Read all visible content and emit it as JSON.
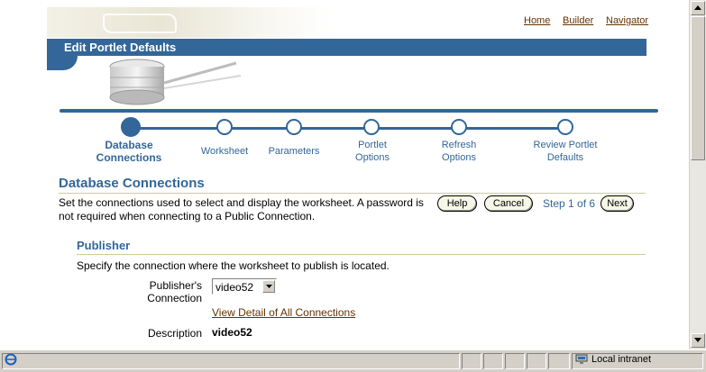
{
  "global_links": [
    "Home",
    "Builder",
    "Navigator"
  ],
  "page_title": "Edit Portlet Defaults",
  "train": {
    "steps": [
      {
        "label1": "Database",
        "label2": "Connections"
      },
      {
        "label1": "Worksheet",
        "label2": ""
      },
      {
        "label1": "Parameters",
        "label2": ""
      },
      {
        "label1": "Portlet",
        "label2": "Options"
      },
      {
        "label1": "Refresh",
        "label2": "Options"
      },
      {
        "label1": "Review Portlet",
        "label2": "Defaults"
      }
    ],
    "active_index": 0
  },
  "section": {
    "title": "Database Connections",
    "instruction": "Set the connections used to select and display the worksheet. A password is not required when connecting to a Public Connection.",
    "help_label": "Help",
    "cancel_label": "Cancel",
    "step_text": "Step 1 of 6",
    "next_label": "Next"
  },
  "publisher": {
    "title": "Publisher",
    "instruction": "Specify the connection where the worksheet to publish is located.",
    "connection_label_1": "Publisher's",
    "connection_label_2": "Connection",
    "connection_value": "video52",
    "detail_link": "View Detail of All Connections",
    "description_label": "Description",
    "description_value": "video52"
  },
  "status": {
    "zone": "Local intranet"
  },
  "colors": {
    "brand_blue": "#336699",
    "link_brown": "#663300",
    "rule_khaki": "#cccc99"
  }
}
